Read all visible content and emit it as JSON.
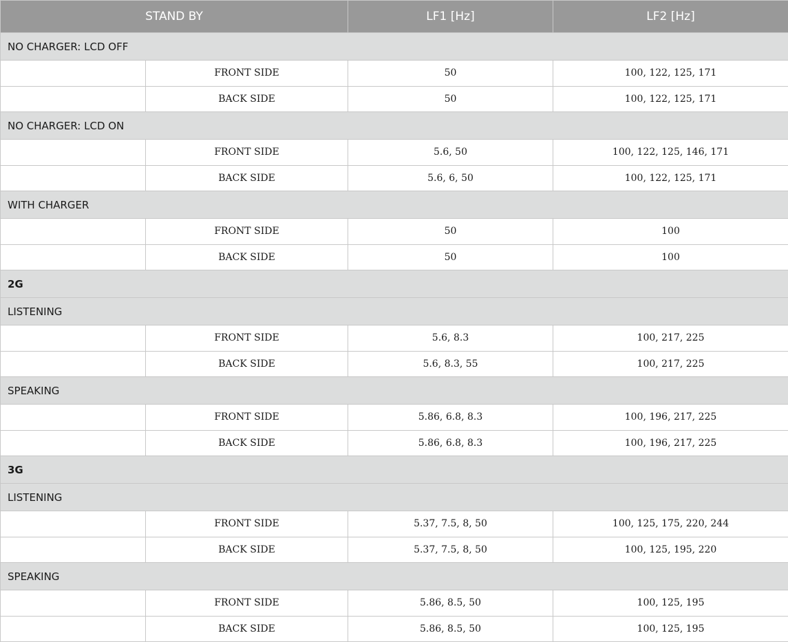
{
  "header": [
    "STAND BY",
    "LF1 [Hz]",
    "LF2 [Hz]"
  ],
  "rows": [
    {
      "type": "section",
      "label": "NO CHARGER: LCD OFF"
    },
    {
      "type": "data",
      "side": "FRONT SIDE",
      "lf1": "50",
      "lf2": "100, 122, 125, 171"
    },
    {
      "type": "data",
      "side": "BACK SIDE",
      "lf1": "50",
      "lf2": "100, 122, 125, 171"
    },
    {
      "type": "section",
      "label": "NO CHARGER: LCD ON"
    },
    {
      "type": "data",
      "side": "FRONT SIDE",
      "lf1": "5.6, 50",
      "lf2": "100, 122, 125, 146, 171"
    },
    {
      "type": "data",
      "side": "BACK SIDE",
      "lf1": "5.6, 6, 50",
      "lf2": "100, 122, 125, 171"
    },
    {
      "type": "section",
      "label": "WITH CHARGER"
    },
    {
      "type": "data",
      "side": "FRONT SIDE",
      "lf1": "50",
      "lf2": "100"
    },
    {
      "type": "data",
      "side": "BACK SIDE",
      "lf1": "50",
      "lf2": "100"
    },
    {
      "type": "section",
      "label": "2G",
      "bold": true
    },
    {
      "type": "section",
      "label": "LISTENING"
    },
    {
      "type": "data",
      "side": "FRONT SIDE",
      "lf1": "5.6, 8.3",
      "lf2": "100, 217, 225"
    },
    {
      "type": "data",
      "side": "BACK SIDE",
      "lf1": "5.6, 8.3, 55",
      "lf2": "100, 217, 225"
    },
    {
      "type": "section",
      "label": "SPEAKING"
    },
    {
      "type": "data",
      "side": "FRONT SIDE",
      "lf1": "5.86, 6.8, 8.3",
      "lf2": "100, 196, 217, 225"
    },
    {
      "type": "data",
      "side": "BACK SIDE",
      "lf1": "5.86, 6.8, 8.3",
      "lf2": "100, 196, 217, 225"
    },
    {
      "type": "section",
      "label": "3G",
      "bold": true
    },
    {
      "type": "section",
      "label": "LISTENING"
    },
    {
      "type": "data",
      "side": "FRONT SIDE",
      "lf1": "5.37, 7.5, 8, 50",
      "lf2": "100, 125, 175, 220, 244"
    },
    {
      "type": "data",
      "side": "BACK SIDE",
      "lf1": "5.37, 7.5, 8, 50",
      "lf2": "100, 125, 195, 220"
    },
    {
      "type": "section",
      "label": "SPEAKING"
    },
    {
      "type": "data",
      "side": "FRONT SIDE",
      "lf1": "5.86, 8.5, 50",
      "lf2": "100, 125, 195"
    },
    {
      "type": "data",
      "side": "BACK SIDE",
      "lf1": "5.86, 8.5, 50",
      "lf2": "100, 125, 195"
    }
  ]
}
